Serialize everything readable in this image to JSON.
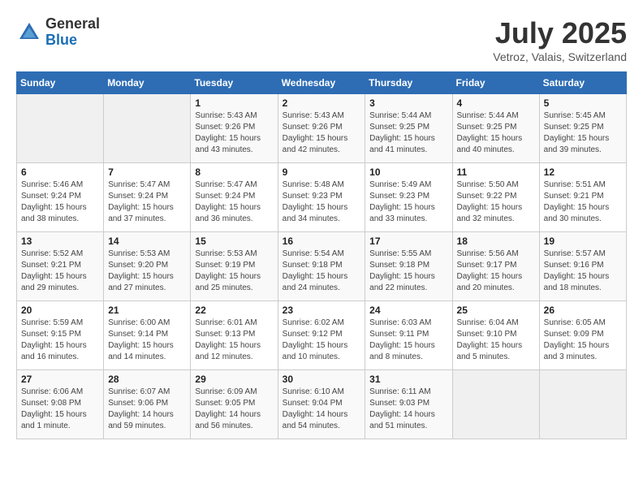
{
  "header": {
    "logo_line1": "General",
    "logo_line2": "Blue",
    "month": "July 2025",
    "location": "Vetroz, Valais, Switzerland"
  },
  "weekdays": [
    "Sunday",
    "Monday",
    "Tuesday",
    "Wednesday",
    "Thursday",
    "Friday",
    "Saturday"
  ],
  "weeks": [
    [
      null,
      null,
      {
        "day": 1,
        "sunrise": "5:43 AM",
        "sunset": "9:26 PM",
        "daylight": "15 hours and 43 minutes."
      },
      {
        "day": 2,
        "sunrise": "5:43 AM",
        "sunset": "9:26 PM",
        "daylight": "15 hours and 42 minutes."
      },
      {
        "day": 3,
        "sunrise": "5:44 AM",
        "sunset": "9:25 PM",
        "daylight": "15 hours and 41 minutes."
      },
      {
        "day": 4,
        "sunrise": "5:44 AM",
        "sunset": "9:25 PM",
        "daylight": "15 hours and 40 minutes."
      },
      {
        "day": 5,
        "sunrise": "5:45 AM",
        "sunset": "9:25 PM",
        "daylight": "15 hours and 39 minutes."
      }
    ],
    [
      {
        "day": 6,
        "sunrise": "5:46 AM",
        "sunset": "9:24 PM",
        "daylight": "15 hours and 38 minutes."
      },
      {
        "day": 7,
        "sunrise": "5:47 AM",
        "sunset": "9:24 PM",
        "daylight": "15 hours and 37 minutes."
      },
      {
        "day": 8,
        "sunrise": "5:47 AM",
        "sunset": "9:24 PM",
        "daylight": "15 hours and 36 minutes."
      },
      {
        "day": 9,
        "sunrise": "5:48 AM",
        "sunset": "9:23 PM",
        "daylight": "15 hours and 34 minutes."
      },
      {
        "day": 10,
        "sunrise": "5:49 AM",
        "sunset": "9:23 PM",
        "daylight": "15 hours and 33 minutes."
      },
      {
        "day": 11,
        "sunrise": "5:50 AM",
        "sunset": "9:22 PM",
        "daylight": "15 hours and 32 minutes."
      },
      {
        "day": 12,
        "sunrise": "5:51 AM",
        "sunset": "9:21 PM",
        "daylight": "15 hours and 30 minutes."
      }
    ],
    [
      {
        "day": 13,
        "sunrise": "5:52 AM",
        "sunset": "9:21 PM",
        "daylight": "15 hours and 29 minutes."
      },
      {
        "day": 14,
        "sunrise": "5:53 AM",
        "sunset": "9:20 PM",
        "daylight": "15 hours and 27 minutes."
      },
      {
        "day": 15,
        "sunrise": "5:53 AM",
        "sunset": "9:19 PM",
        "daylight": "15 hours and 25 minutes."
      },
      {
        "day": 16,
        "sunrise": "5:54 AM",
        "sunset": "9:18 PM",
        "daylight": "15 hours and 24 minutes."
      },
      {
        "day": 17,
        "sunrise": "5:55 AM",
        "sunset": "9:18 PM",
        "daylight": "15 hours and 22 minutes."
      },
      {
        "day": 18,
        "sunrise": "5:56 AM",
        "sunset": "9:17 PM",
        "daylight": "15 hours and 20 minutes."
      },
      {
        "day": 19,
        "sunrise": "5:57 AM",
        "sunset": "9:16 PM",
        "daylight": "15 hours and 18 minutes."
      }
    ],
    [
      {
        "day": 20,
        "sunrise": "5:59 AM",
        "sunset": "9:15 PM",
        "daylight": "15 hours and 16 minutes."
      },
      {
        "day": 21,
        "sunrise": "6:00 AM",
        "sunset": "9:14 PM",
        "daylight": "15 hours and 14 minutes."
      },
      {
        "day": 22,
        "sunrise": "6:01 AM",
        "sunset": "9:13 PM",
        "daylight": "15 hours and 12 minutes."
      },
      {
        "day": 23,
        "sunrise": "6:02 AM",
        "sunset": "9:12 PM",
        "daylight": "15 hours and 10 minutes."
      },
      {
        "day": 24,
        "sunrise": "6:03 AM",
        "sunset": "9:11 PM",
        "daylight": "15 hours and 8 minutes."
      },
      {
        "day": 25,
        "sunrise": "6:04 AM",
        "sunset": "9:10 PM",
        "daylight": "15 hours and 5 minutes."
      },
      {
        "day": 26,
        "sunrise": "6:05 AM",
        "sunset": "9:09 PM",
        "daylight": "15 hours and 3 minutes."
      }
    ],
    [
      {
        "day": 27,
        "sunrise": "6:06 AM",
        "sunset": "9:08 PM",
        "daylight": "15 hours and 1 minute."
      },
      {
        "day": 28,
        "sunrise": "6:07 AM",
        "sunset": "9:06 PM",
        "daylight": "14 hours and 59 minutes."
      },
      {
        "day": 29,
        "sunrise": "6:09 AM",
        "sunset": "9:05 PM",
        "daylight": "14 hours and 56 minutes."
      },
      {
        "day": 30,
        "sunrise": "6:10 AM",
        "sunset": "9:04 PM",
        "daylight": "14 hours and 54 minutes."
      },
      {
        "day": 31,
        "sunrise": "6:11 AM",
        "sunset": "9:03 PM",
        "daylight": "14 hours and 51 minutes."
      },
      null,
      null
    ]
  ]
}
